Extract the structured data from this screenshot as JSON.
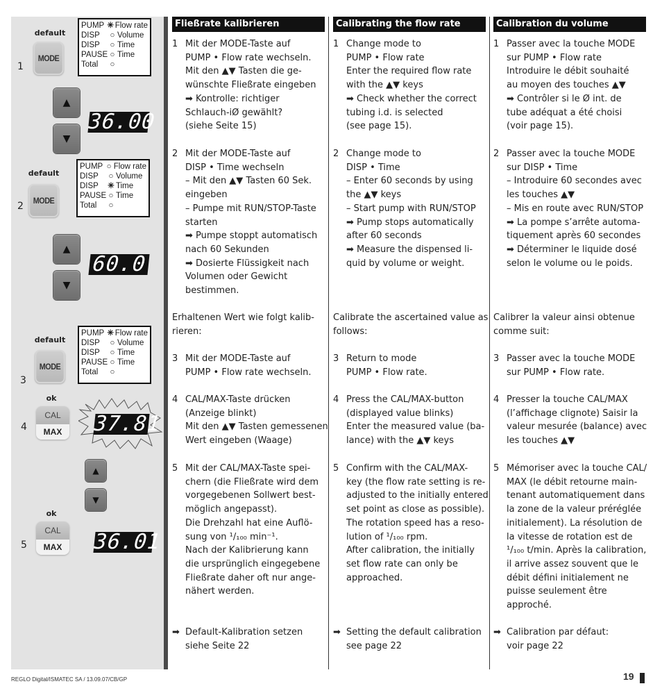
{
  "illustration": {
    "steps": [
      {
        "num": "1",
        "button_caption": "default",
        "button": "MODE",
        "active_mode": 0,
        "arrows": true,
        "display": "36.00"
      },
      {
        "num": "2",
        "button_caption": "default",
        "button": "MODE",
        "active_mode": 2,
        "arrows": true,
        "display": "60.0"
      },
      {
        "num": "3",
        "button_caption": "default",
        "button": "MODE",
        "active_mode": 0
      },
      {
        "num": "4",
        "button_caption": "ok",
        "button_top": "CAL",
        "button_bottom": "MAX",
        "display": "37.81",
        "display_blinking": true
      },
      {
        "num": "5",
        "button_caption": "ok",
        "button_top": "CAL",
        "button_bottom": "MAX",
        "arrows": true,
        "display": "36.01"
      }
    ],
    "modes": [
      {
        "name": "PUMP",
        "label": "Flow rate"
      },
      {
        "name": "DISP",
        "label": "Volume"
      },
      {
        "name": "DISP",
        "label": "Time"
      },
      {
        "name": "PAUSE",
        "label": "Time"
      },
      {
        "name": "Total",
        "label": ""
      }
    ],
    "indicator_on": "✳",
    "indicator_off": "○",
    "arrow_up": "▲",
    "arrow_down": "▼"
  },
  "columns": {
    "de": {
      "heading": "Fließrate kalibrieren",
      "s1": {
        "n": "1",
        "lines": [
          "Mit der MODE-Taste auf",
          "PUMP • Flow rate wechseln.",
          "Mit den ▲▼ Tasten die ge-",
          "wünschte Fließrate eingeben",
          "➡ Kontrolle: richtiger",
          "Schlauch-iØ gewählt?",
          "(siehe Seite 15)"
        ]
      },
      "s2": {
        "n": "2",
        "lines": [
          "Mit der MODE-Taste auf",
          "DISP • Time wechseln",
          "–   Mit den ▲▼ Tasten 60 Sek.",
          "eingeben",
          "–   Pumpe mit RUN/STOP-Taste",
          "starten",
          "➡ Pumpe stoppt automatisch",
          "nach 60 Sekunden",
          "➡ Dosierte Flüssigkeit nach",
          "Volumen oder Gewicht",
          "bestimmen."
        ]
      },
      "intro": [
        "Erhaltenen Wert wie folgt kalib-",
        "rieren:"
      ],
      "s3": {
        "n": "3",
        "lines": [
          "Mit der MODE-Taste auf",
          "PUMP • Flow rate wechseln."
        ]
      },
      "s4": {
        "n": "4",
        "lines": [
          "CAL/MAX-Taste drücken",
          "(Anzeige blinkt)",
          "Mit den ▲▼ Tasten gemessenen",
          "Wert eingeben (Waage)"
        ]
      },
      "s5": {
        "n": "5",
        "lines": [
          "Mit der CAL/MAX-Taste spei-",
          "chern (die Fließrate wird dem",
          "vorgegebenen Sollwert best-",
          "möglich angepasst).",
          "Die Drehzahl hat eine Auflö-",
          "sung von ¹/₁₀₀ min⁻¹.",
          "Nach der Kalibrierung kann",
          "die ursprünglich eingegebene",
          "Fließrate daher oft nur ange-",
          "nähert werden."
        ]
      },
      "note": {
        "n": "➡",
        "lines": [
          "Default-Kalibration setzen",
          "siehe Seite 22"
        ]
      }
    },
    "en": {
      "heading": "Calibrating the flow rate",
      "s1": {
        "n": "1",
        "lines": [
          "Change mode to",
          "PUMP • Flow rate",
          "Enter the required flow rate",
          "with the ▲▼  keys",
          "➡ Check whether the correct",
          "tubing i.d. is selected",
          "(see page 15)."
        ]
      },
      "s2": {
        "n": "2",
        "lines": [
          "Change mode to",
          "DISP • Time",
          "–   Enter 60 seconds by using",
          "the ▲▼  keys",
          "–   Start pump with RUN/STOP",
          "➡ Pump stops automatically",
          "after 60 seconds",
          "➡ Measure the dispensed li-",
          "quid by volume or weight."
        ]
      },
      "intro": [
        "Calibrate the ascertained value as",
        "follows:"
      ],
      "s3": {
        "n": "3",
        "lines": [
          "Return to mode",
          "PUMP • Flow rate."
        ]
      },
      "s4": {
        "n": "4",
        "lines": [
          "Press the CAL/MAX-button",
          "(displayed value blinks)",
          "Enter the measured value (ba-",
          "lance) with the ▲▼ keys"
        ]
      },
      "s5": {
        "n": "5",
        "lines": [
          "Confirm with the CAL/MAX-",
          "key (the flow rate setting is re-",
          "adjusted to the initially entered",
          "set point as close as possible).",
          "The rotation speed has a reso-",
          "lution of ¹/₁₀₀ rpm.",
          "After calibration, the initially",
          "set flow rate can only be",
          "approached."
        ]
      },
      "note": {
        "n": "➡",
        "lines": [
          "Setting the default calibration",
          "see page 22"
        ]
      }
    },
    "fr": {
      "heading": "Calibration du volume",
      "s1": {
        "n": "1",
        "lines": [
          "Passer avec la touche MODE",
          "sur PUMP • Flow rate",
          "Introduire le débit souhaité",
          "au moyen des touches ▲▼",
          "➡ Contrôler si le Ø int. de",
          "tube adéquat a été choisi",
          "(voir page 15)."
        ]
      },
      "s2": {
        "n": "2",
        "lines": [
          "Passer avec la touche MODE",
          "sur DISP • Time",
          "–   Introduire 60 secondes avec",
          "les touches ▲▼",
          "–   Mis en route avec RUN/STOP",
          "➡ La pompe s’arrête automa-",
          "tiquement après 60 secondes",
          "➡ Déterminer le liquide dosé",
          "selon le volume ou le poids."
        ]
      },
      "intro": [
        "Calibrer la valeur ainsi obtenue",
        "comme suit:"
      ],
      "s3": {
        "n": "3",
        "lines": [
          "Passer avec la touche MODE",
          "sur PUMP • Flow rate."
        ]
      },
      "s4": {
        "n": "4",
        "lines": [
          "Presser la touche CAL/MAX",
          "(l’affichage clignote) Saisir la",
          "valeur mesurée (balance) avec",
          "les touches ▲▼"
        ]
      },
      "s5": {
        "n": "5",
        "lines": [
          "Mémoriser avec la touche CAL/",
          "MAX (le débit retourne main-",
          "tenant automatiquement dans",
          "la zone de la valeur préréglée",
          "initialement). La résolution de",
          "la vitesse de rotation est de",
          "¹/₁₀₀ t/min. Après la calibration,",
          "il arrive assez souvent que le",
          "débit défini initialement ne",
          "puisse seulement être",
          "approché."
        ]
      },
      "note": {
        "n": "➡",
        "lines": [
          "Calibration par défaut:",
          "voir page 22"
        ]
      }
    }
  },
  "footer": {
    "left": "REGLO Digital/ISMATEC SA / 13.09.07/CB/GP",
    "page": "19"
  }
}
